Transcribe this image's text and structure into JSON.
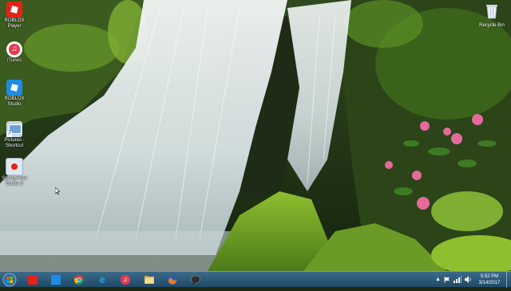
{
  "desktop": {
    "icons": [
      {
        "label": "ROBLOX Player",
        "icon": "roblox-icon",
        "color": "#e2231a"
      },
      {
        "label": "iTunes",
        "icon": "itunes-icon",
        "color": "#e8384f"
      },
      {
        "label": "ROBLOX Studio",
        "icon": "roblox-studio-icon",
        "color": "#1c8ce5"
      },
      {
        "label": "Pictures - Shortcut",
        "icon": "pictures-shortcut-icon",
        "color": "#c9d7e6"
      },
      {
        "label": "Spring Free Game 3",
        "icon": "spring-free-game-icon",
        "color": "#dfe6ee"
      }
    ],
    "recycle_bin": {
      "label": "Recycle Bin",
      "icon": "recycle-bin-icon"
    }
  },
  "taskbar": {
    "start_icon": "windows-start-icon",
    "pinned": [
      {
        "name": "roblox",
        "icon": "roblox-icon",
        "color": "#e2231a"
      },
      {
        "name": "roblox-studio",
        "icon": "roblox-studio-icon",
        "color": "#1c8ce5"
      },
      {
        "name": "chrome",
        "icon": "chrome-icon",
        "color": "#db4437"
      },
      {
        "name": "internet-explorer",
        "icon": "internet-explorer-icon",
        "color": "#1ea1e0"
      },
      {
        "name": "itunes",
        "icon": "itunes-icon",
        "color": "#e8384f"
      },
      {
        "name": "file-explorer",
        "icon": "file-explorer-icon",
        "color": "#e9c46a"
      },
      {
        "name": "firefox",
        "icon": "firefox-icon",
        "color": "#f07a1e"
      },
      {
        "name": "chat",
        "icon": "chat-icon",
        "color": "#2d2d2d"
      }
    ],
    "tray": {
      "overflow": "▲",
      "clock_time": "5:52 PM",
      "clock_date": "3/14/2017"
    }
  }
}
